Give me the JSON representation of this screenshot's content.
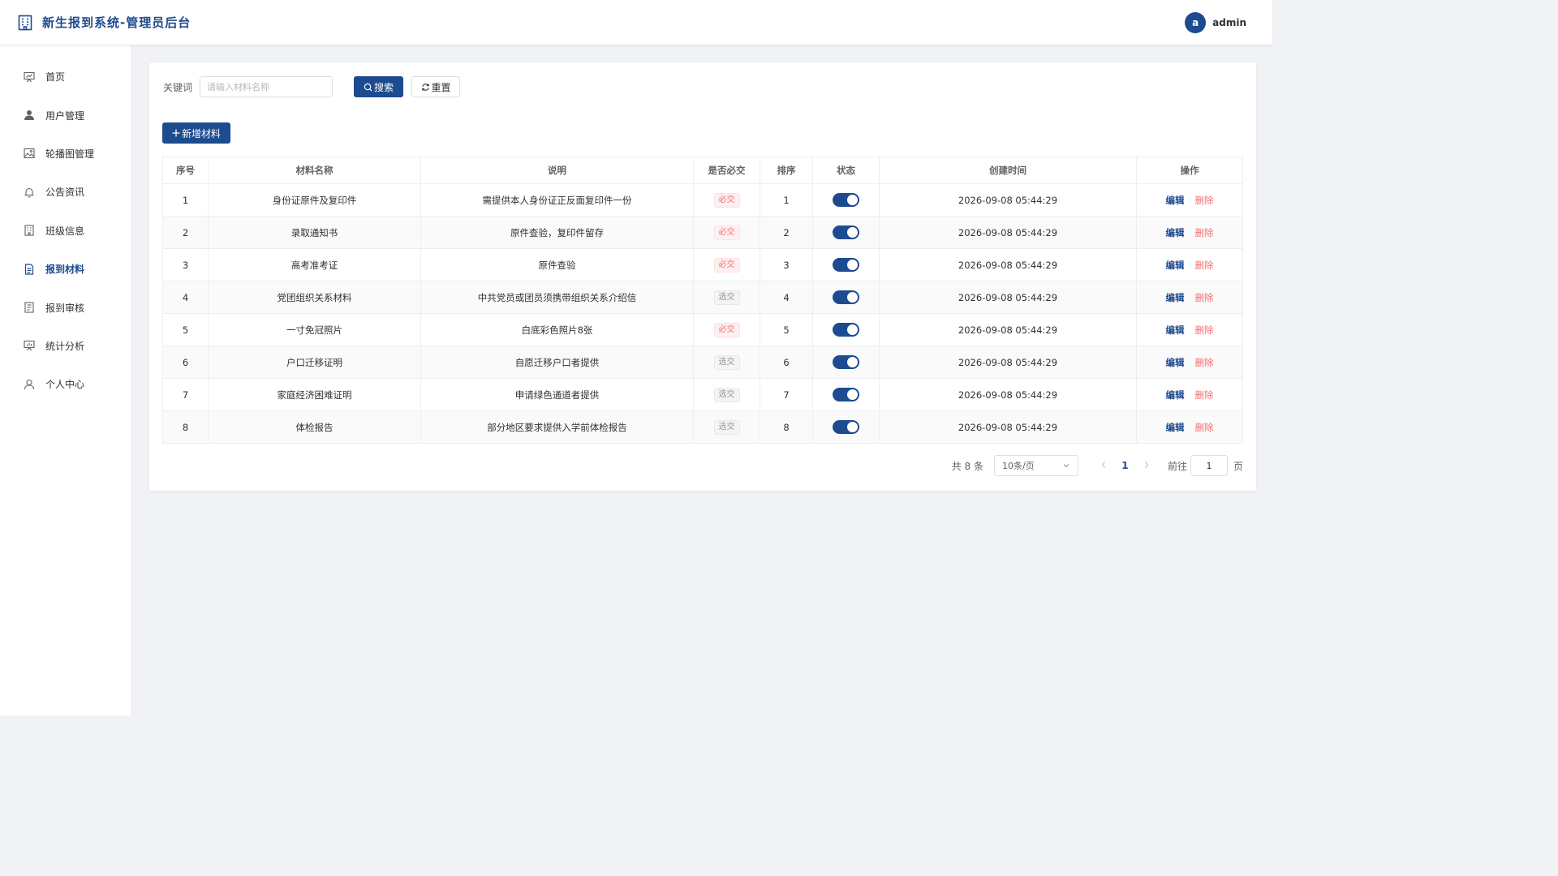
{
  "header": {
    "title": "新生报到系统-管理员后台",
    "user_initial": "a",
    "username": "admin"
  },
  "sidebar": {
    "items": [
      {
        "label": "首页",
        "icon": "presentation-chart-icon"
      },
      {
        "label": "用户管理",
        "icon": "user-filled-icon"
      },
      {
        "label": "轮播图管理",
        "icon": "picture-icon"
      },
      {
        "label": "公告资讯",
        "icon": "bell-icon"
      },
      {
        "label": "班级信息",
        "icon": "building-icon"
      },
      {
        "label": "报到材料",
        "icon": "document-icon",
        "active": true
      },
      {
        "label": "报到审核",
        "icon": "list-document-icon"
      },
      {
        "label": "统计分析",
        "icon": "data-board-icon"
      },
      {
        "label": "个人中心",
        "icon": "user-icon"
      }
    ]
  },
  "search": {
    "label": "关键词",
    "placeholder": "请输入材料名称",
    "value": "",
    "search_button": "搜索",
    "reset_button": "重置"
  },
  "toolbar": {
    "add_button": "新增材料"
  },
  "table": {
    "headers": [
      "序号",
      "材料名称",
      "说明",
      "是否必交",
      "排序",
      "状态",
      "创建时间",
      "操作"
    ],
    "rows": [
      {
        "index": "1",
        "name": "身份证原件及复印件",
        "desc": "需提供本人身份证正反面复印件一份",
        "required": "必交",
        "req": true,
        "sort": "1",
        "enabled": true,
        "created": "2026-09-08 05:44:29"
      },
      {
        "index": "2",
        "name": "录取通知书",
        "desc": "原件查验，复印件留存",
        "required": "必交",
        "req": true,
        "sort": "2",
        "enabled": true,
        "created": "2026-09-08 05:44:29"
      },
      {
        "index": "3",
        "name": "高考准考证",
        "desc": "原件查验",
        "required": "必交",
        "req": true,
        "sort": "3",
        "enabled": true,
        "created": "2026-09-08 05:44:29"
      },
      {
        "index": "4",
        "name": "党团组织关系材料",
        "desc": "中共党员或团员须携带组织关系介绍信",
        "required": "选交",
        "req": false,
        "sort": "4",
        "enabled": true,
        "created": "2026-09-08 05:44:29"
      },
      {
        "index": "5",
        "name": "一寸免冠照片",
        "desc": "白底彩色照片8张",
        "required": "必交",
        "req": true,
        "sort": "5",
        "enabled": true,
        "created": "2026-09-08 05:44:29"
      },
      {
        "index": "6",
        "name": "户口迁移证明",
        "desc": "自愿迁移户口者提供",
        "required": "选交",
        "req": false,
        "sort": "6",
        "enabled": true,
        "created": "2026-09-08 05:44:29"
      },
      {
        "index": "7",
        "name": "家庭经济困难证明",
        "desc": "申请绿色通道者提供",
        "required": "选交",
        "req": false,
        "sort": "7",
        "enabled": true,
        "created": "2026-09-08 05:44:29"
      },
      {
        "index": "8",
        "name": "体检报告",
        "desc": "部分地区要求提供入学前体检报告",
        "required": "选交",
        "req": false,
        "sort": "8",
        "enabled": true,
        "created": "2026-09-08 05:44:29"
      }
    ],
    "edit_label": "编辑",
    "delete_label": "删除"
  },
  "pagination": {
    "total": "共 8 条",
    "page_size": "10条/页",
    "current_page": "1",
    "goto_label": "前往",
    "goto_value": "1",
    "goto_suffix": "页"
  },
  "colors": {
    "primary": "#1d4b8f",
    "danger": "#f56c6c",
    "background": "#f0f2f5"
  }
}
